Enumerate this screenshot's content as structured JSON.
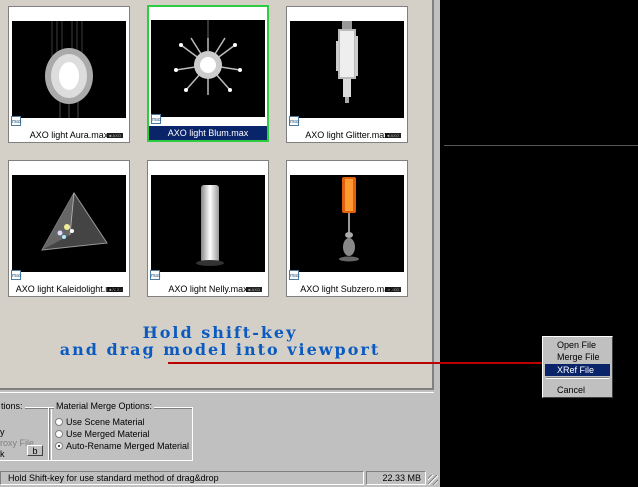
{
  "tiles": [
    {
      "caption": "AXO light Aura.max",
      "selected": false
    },
    {
      "caption": "AXO light Blum.max",
      "selected": true
    },
    {
      "caption": "AXO light Glitter.max",
      "selected": false
    },
    {
      "caption": "AXO light Kaleidolight.max",
      "selected": false
    },
    {
      "caption": "AXO light Nelly.max",
      "selected": false
    },
    {
      "caption": "AXO light Subzero.max",
      "selected": false
    }
  ],
  "hint": {
    "line1": "Hold shift-key",
    "line2": "and drag model into viewport"
  },
  "options": {
    "left_legend": "tions:",
    "left_items": [
      "y",
      "roxy File",
      "k"
    ],
    "b_button": "b",
    "material_legend": "Material Merge Options:",
    "material_items": [
      {
        "label": "Use Scene Material",
        "checked": false
      },
      {
        "label": "Use Merged Material",
        "checked": false
      },
      {
        "label": "Auto-Rename Merged Material",
        "checked": true
      }
    ]
  },
  "status": {
    "message": "Hold Shift-key for use standard method of drag&drop",
    "memory": "22.33 MB"
  },
  "context_menu": {
    "items": [
      {
        "label": "Open File",
        "active": false
      },
      {
        "label": "Merge File",
        "active": false
      },
      {
        "label": "XRef File",
        "active": true
      },
      {
        "label": "Cancel",
        "active": false
      }
    ]
  },
  "colors": {
    "selection": "#0a246a",
    "selected_border": "#2ecc40",
    "hint_text": "#0a5ac0",
    "drag_line": "#bb0000"
  }
}
